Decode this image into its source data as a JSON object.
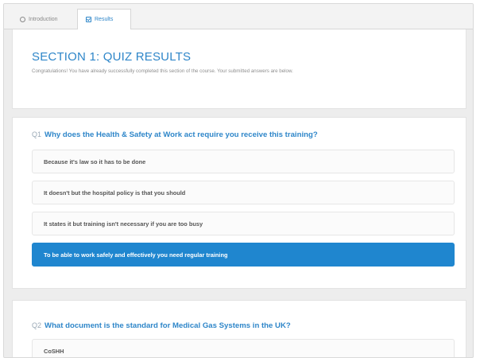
{
  "tabs": [
    {
      "label": "Introduction",
      "icon": "clock-icon"
    },
    {
      "label": "Results",
      "icon": "checkbox-icon"
    }
  ],
  "header": {
    "title": "SECTION 1: QUIZ RESULTS",
    "subtitle": "Congratulations! You have already successfully completed this section of the course. Your submitted answers are below."
  },
  "questions": [
    {
      "number": "Q1",
      "text": "Why does the Health & Safety at Work act require you receive this training?",
      "options": [
        "Because it's law so it has to be done",
        "It doesn't but the hospital policy is that you should",
        "It states it but training isn't necessary if you are too busy",
        "To be able to work safely and effectively you need regular training"
      ],
      "selected_index": 3
    },
    {
      "number": "Q2",
      "text": "What document is the standard for Medical Gas Systems in the UK?",
      "options": [
        "CoSHH"
      ]
    }
  ],
  "colors": {
    "accent": "#2e86c9",
    "selected": "#1f86cf"
  }
}
